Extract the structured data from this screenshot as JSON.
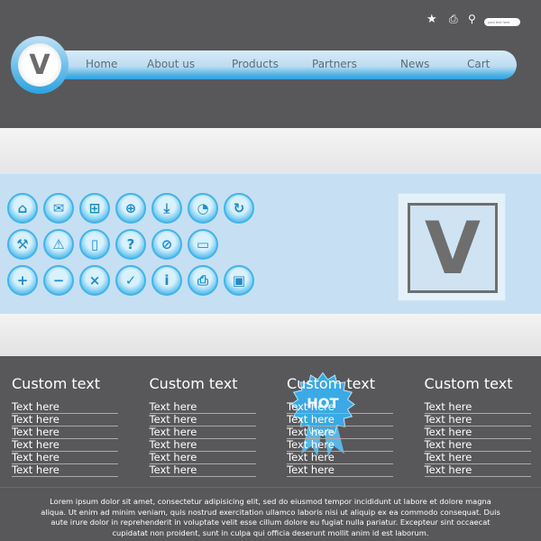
{
  "header": {
    "search_placeholder": "your text here",
    "tools": [
      "star-icon",
      "printer-icon",
      "search-icon"
    ],
    "logo_letter": "V"
  },
  "nav": {
    "items": [
      "Home",
      "About us",
      "Products",
      "Partners",
      "News",
      "Cart"
    ]
  },
  "icons": [
    [
      "home",
      "mail",
      "cart",
      "globe",
      "download",
      "rss",
      "refresh"
    ],
    [
      "wrench",
      "warning",
      "phone",
      "help",
      "forbidden",
      "credit-card"
    ],
    [
      "plus",
      "minus",
      "close",
      "check",
      "info",
      "printer",
      "save"
    ]
  ],
  "badge": {
    "text": "HOT"
  },
  "banner": {
    "logo_letter": "V"
  },
  "colors": {
    "accent": "#2aa5e3",
    "dark": "#58585a",
    "panel": "#c6dff2"
  },
  "columns": [
    {
      "title": "Custom text",
      "items": [
        "Text here",
        "Text here",
        "Text here",
        "Text here",
        "Text here",
        "Text here"
      ]
    },
    {
      "title": "Custom text",
      "items": [
        "Text here",
        "Text here",
        "Text here",
        "Text here",
        "Text here",
        "Text here"
      ]
    },
    {
      "title": "Custom text",
      "items": [
        "Text here",
        "Text here",
        "Text here",
        "Text here",
        "Text here",
        "Text here"
      ]
    },
    {
      "title": "Custom text",
      "items": [
        "Text here",
        "Text here",
        "Text here",
        "Text here",
        "Text here",
        "Text here"
      ]
    }
  ],
  "footer": {
    "text": "Lorem ipsum dolor sit amet, consectetur adipisicing elit, sed do eiusmod tempor incididunt ut labore et dolore magna aliqua. Ut enim ad minim veniam, quis nostrud exercitation ullamco laboris nisi ut aliquip ex ea commodo consequat. Duis aute irure dolor in reprehenderit in voluptate velit esse cillum dolore eu fugiat nulla pariatur. Excepteur sint occaecat cupidatat non proident, sunt in culpa qui officia deserunt mollit anim id est laborum."
  }
}
